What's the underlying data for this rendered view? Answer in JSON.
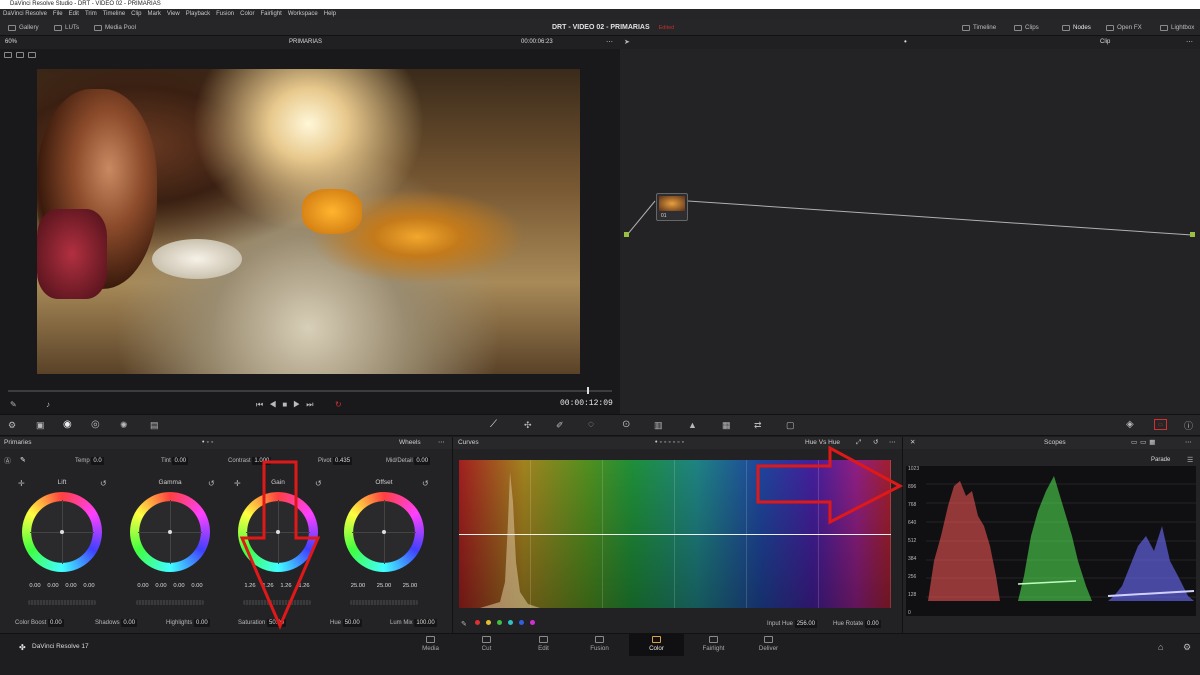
{
  "app_title": "DaVinci Resolve Studio - DRT - VIDEO 02 - PRIMARIAS",
  "menu": [
    "DaVinci Resolve",
    "File",
    "Edit",
    "Trim",
    "Timeline",
    "Clip",
    "Mark",
    "View",
    "Playback",
    "Fusion",
    "Color",
    "Fairlight",
    "Workspace",
    "Help"
  ],
  "toolbar": {
    "gallery": "Gallery",
    "luts": "LUTs",
    "media_pool": "Media Pool",
    "project_title": "DRT - VIDEO 02 - PRIMARIAS",
    "edited": "Edited",
    "timeline": "Timeline",
    "clips": "Clips",
    "nodes": "Nodes",
    "openfx": "Open FX",
    "lightbox": "Lightbox"
  },
  "viewer": {
    "zoom": "60%",
    "clip_name": "PRIMARIAS",
    "timecode_top": "00:00:06:23",
    "timecode_bottom": "00:00:12:09",
    "playhead_fraction": 0.96
  },
  "nodes": {
    "mode": "Clip",
    "node_label": "01"
  },
  "primaries": {
    "title": "Primaries",
    "mode": "Wheels",
    "temp_label": "Temp",
    "temp": "0.0",
    "tint_label": "Tint",
    "tint": "0.00",
    "contrast_label": "Contrast",
    "contrast": "1.000",
    "pivot_label": "Pivot",
    "pivot": "0.435",
    "middetail_label": "Mid/Detail",
    "middetail": "0.00",
    "wheels": [
      {
        "name": "Lift",
        "values": [
          "0.00",
          "0.00",
          "0.00",
          "0.00"
        ]
      },
      {
        "name": "Gamma",
        "values": [
          "0.00",
          "0.00",
          "0.00",
          "0.00"
        ]
      },
      {
        "name": "Gain",
        "values": [
          "1.26",
          "1.26",
          "1.26",
          "1.26"
        ]
      },
      {
        "name": "Offset",
        "values": [
          "25.00",
          "25.00",
          "25.00"
        ]
      }
    ],
    "colorboost_label": "Color Boost",
    "colorboost": "0.00",
    "shadows_label": "Shadows",
    "shadows": "0.00",
    "highlights_label": "Highlights",
    "highlights": "0.00",
    "saturation_label": "Saturation",
    "saturation": "50.00",
    "hue_label": "Hue",
    "hue": "50.00",
    "lummix_label": "Lum Mix",
    "lummix": "100.00"
  },
  "curves": {
    "title": "Curves",
    "mode": "Hue Vs Hue",
    "input_hue_label": "Input Hue",
    "input_hue": "256.00",
    "hue_rotate_label": "Hue Rotate",
    "hue_rotate": "0.00"
  },
  "scopes": {
    "title": "Scopes",
    "mode": "Parade",
    "scale": [
      "1023",
      "896",
      "768",
      "640",
      "512",
      "384",
      "256",
      "128",
      "0"
    ]
  },
  "bottom": {
    "app_name": "DaVinci Resolve 17",
    "pages": [
      "Media",
      "Cut",
      "Edit",
      "Fusion",
      "Color",
      "Fairlight",
      "Deliver"
    ],
    "active_page": "Color"
  },
  "colors": {
    "accent": "#e0a040",
    "annotation_arrow": "#e01818"
  }
}
